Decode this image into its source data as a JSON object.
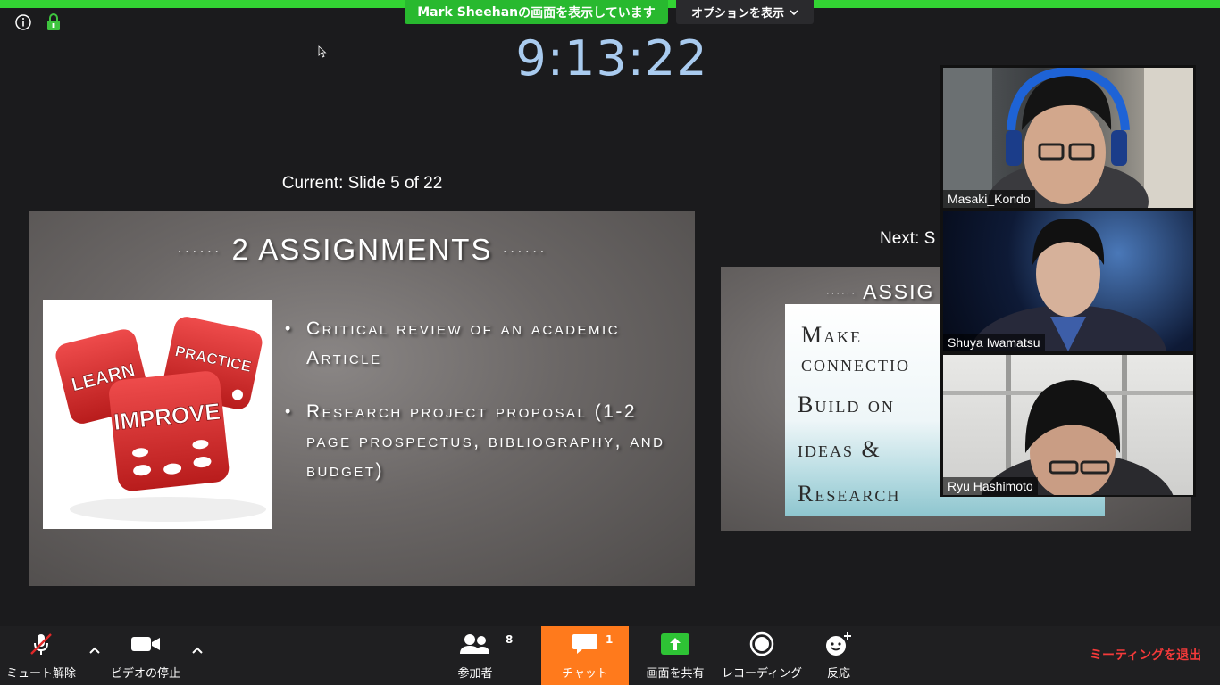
{
  "window": {
    "share_banner_name": "Mark  Sheehan",
    "share_banner_suffix": " の画面を表示しています",
    "options_label": "オプションを表示"
  },
  "presenter_view": {
    "clock": "9:13:22",
    "current_label": "Current: Slide 5 of 22",
    "next_label": "Next: S"
  },
  "current_slide": {
    "title": "2 ASSIGNMENTS",
    "dots": "······",
    "image_words": [
      "LEARN",
      "PRACTICE",
      "IMPROVE"
    ],
    "bullets": [
      "Critical review of an academic Article",
      "Research project proposal (1-2 page prospectus, bibliography, and budget)"
    ]
  },
  "next_slide": {
    "title": "ASSIG",
    "dots": "······",
    "lines": [
      "Make",
      "connectio",
      "Build on",
      "ideas &",
      "Research"
    ]
  },
  "participants": [
    {
      "name": "Masaki_Kondo"
    },
    {
      "name": "Shuya Iwamatsu"
    },
    {
      "name": "Ryu Hashimoto"
    }
  ],
  "toolbar": {
    "unmute_label": "ミュート解除",
    "video_label": "ビデオの停止",
    "participants_label": "参加者",
    "participants_count": "8",
    "chat_label": "チャット",
    "chat_count": "1",
    "share_label": "画面を共有",
    "record_label": "レコーディング",
    "reactions_label": "反応",
    "leave_label": "ミーティングを退出"
  },
  "colors": {
    "accent_green": "#28b92f",
    "chat_orange": "#ff7a1c",
    "leave_red": "#f43a3a",
    "clock_blue": "#a9cbef"
  }
}
